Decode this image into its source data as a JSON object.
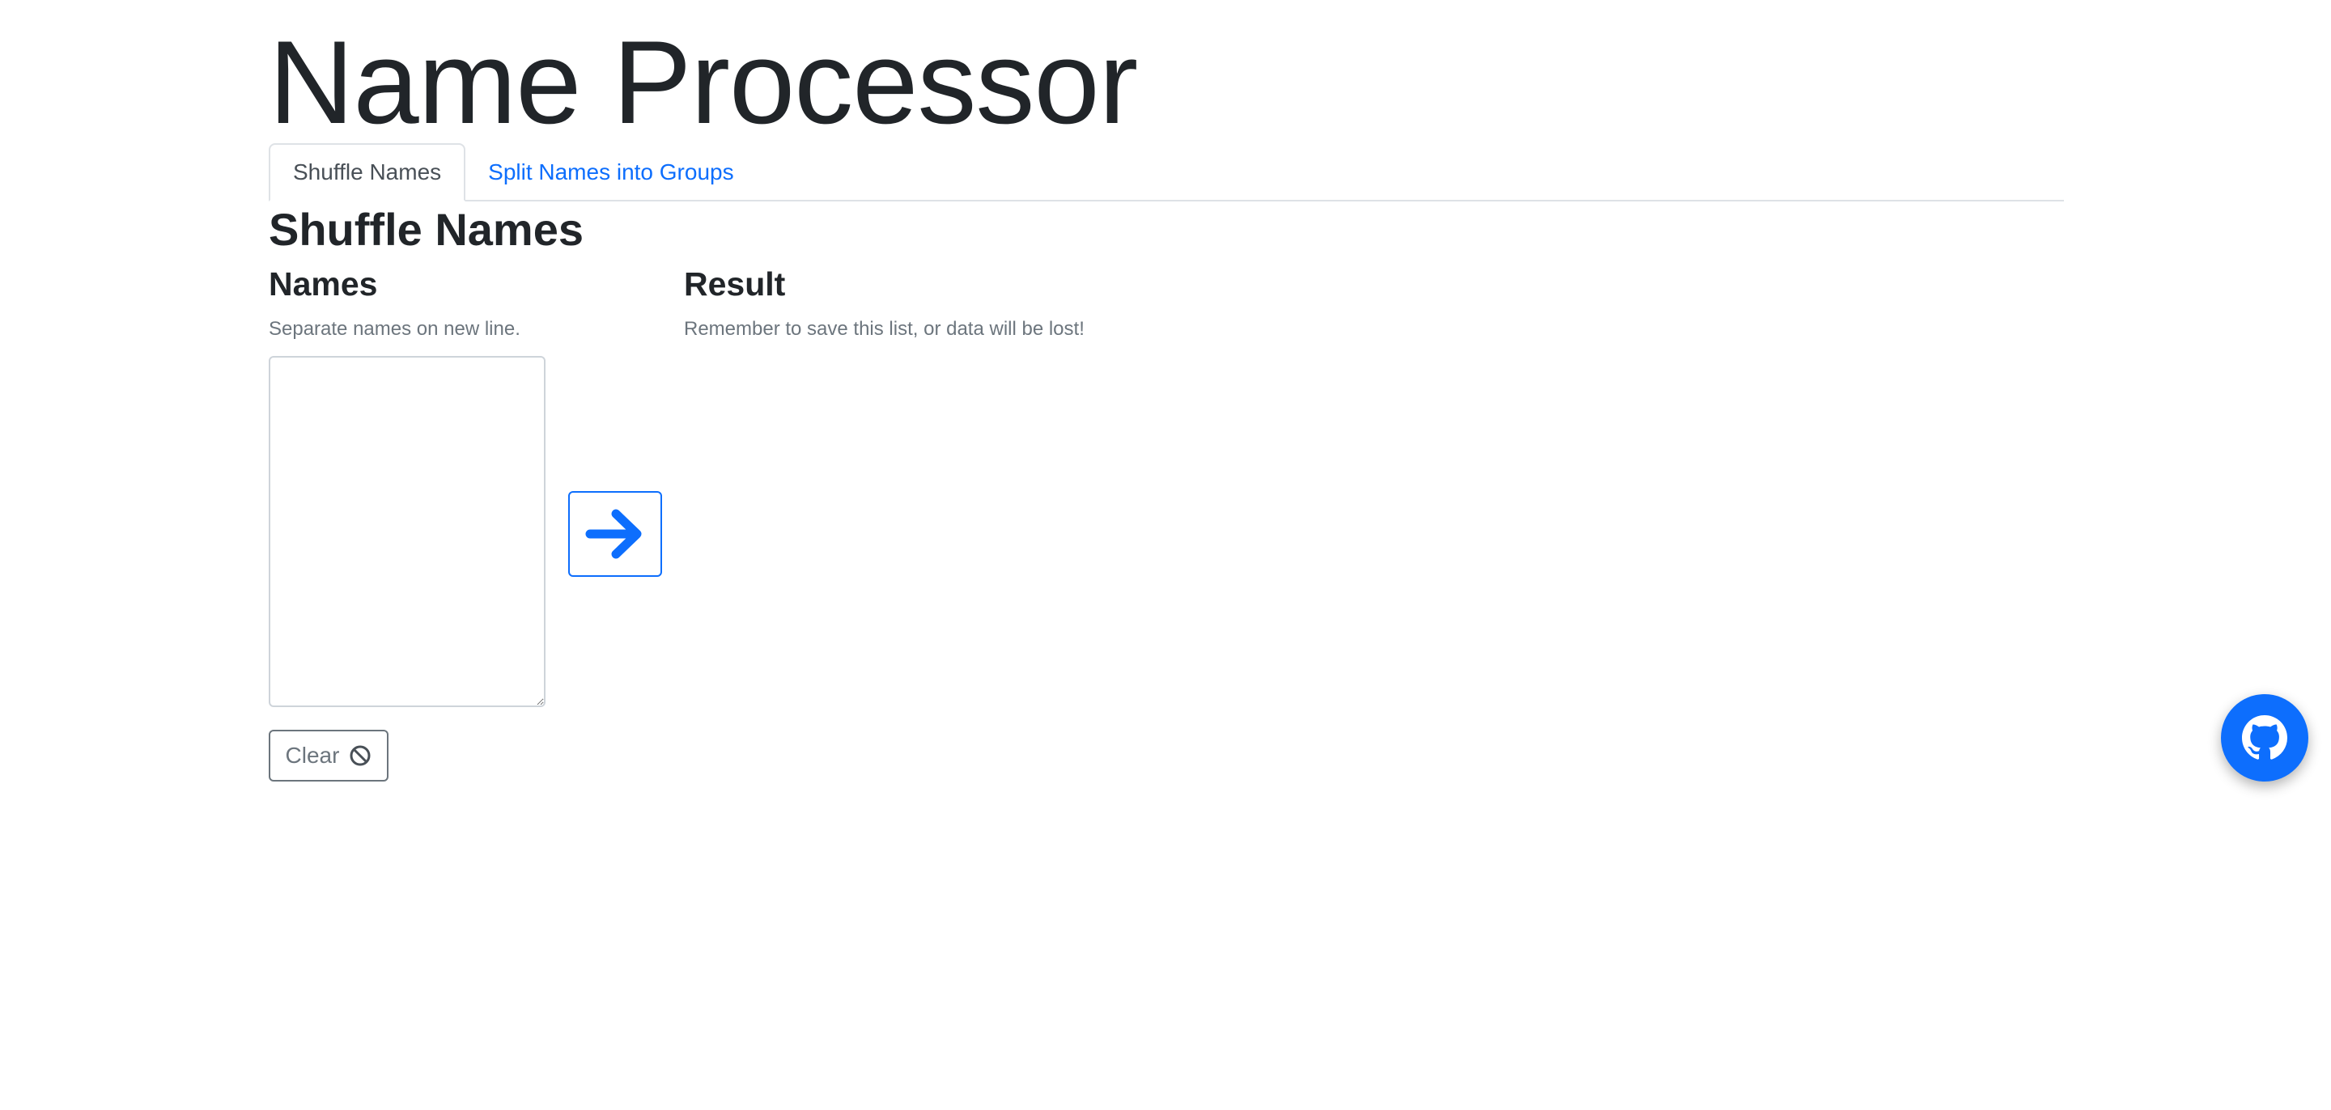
{
  "header": {
    "title": "Name Processor"
  },
  "tabs": [
    {
      "label": "Shuffle Names",
      "active": true
    },
    {
      "label": "Split Names into Groups",
      "active": false
    }
  ],
  "main": {
    "section_title": "Shuffle Names",
    "names": {
      "heading": "Names",
      "help": "Separate names on new line.",
      "value": ""
    },
    "result": {
      "heading": "Result",
      "help": "Remember to save this list, or data will be lost!"
    },
    "process_button": {
      "icon": "arrow-right-icon"
    },
    "clear_button": {
      "label": "Clear",
      "icon": "ban-icon"
    }
  },
  "fab": {
    "icon": "github-icon"
  },
  "colors": {
    "primary": "#0d6efd",
    "secondary": "#6c757d",
    "text": "#212529",
    "border": "#dee2e6"
  }
}
